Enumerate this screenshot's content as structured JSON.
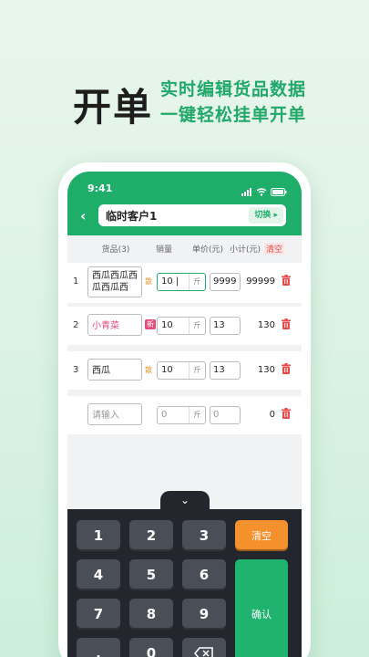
{
  "hero": {
    "title": "开单",
    "line1": "实时编辑货品数据",
    "line2": "一键轻松挂单开单"
  },
  "status": {
    "time": "9:41"
  },
  "header": {
    "back_glyph": "‹",
    "customer": "临时客户1",
    "switch_label": "切换 ▸"
  },
  "table": {
    "headers": {
      "goods": "货品(3)",
      "qty": "销量",
      "price": "单价(元)",
      "subtotal": "小计(元)",
      "clear": "清空"
    },
    "rows": [
      {
        "index": "1",
        "name": "西瓜西瓜西瓜西瓜西",
        "tag": "散",
        "qty": "10 |",
        "unit": "斤",
        "price": "9999",
        "subtotal": "99999"
      },
      {
        "index": "2",
        "name": "小青菜",
        "tag": "新",
        "qty": "10",
        "unit": "斤",
        "price": "13",
        "subtotal": "130"
      },
      {
        "index": "3",
        "name": "西瓜",
        "tag": "散",
        "qty": "10",
        "unit": "斤",
        "price": "13",
        "subtotal": "130"
      },
      {
        "index": "",
        "name": "请输入",
        "tag": "",
        "qty": "0",
        "unit": "斤",
        "price": "0",
        "subtotal": "0"
      }
    ]
  },
  "keyboard": {
    "keys": [
      "1",
      "2",
      "3",
      "4",
      "5",
      "6",
      "7",
      "8",
      "9",
      ".",
      "0"
    ],
    "clear_label": "清空",
    "confirm_label": "确认",
    "collapse_glyph": "⌄"
  },
  "colors": {
    "brand": "#1fae6a",
    "accent_pink": "#e7497b",
    "accent_orange": "#f5912c"
  }
}
